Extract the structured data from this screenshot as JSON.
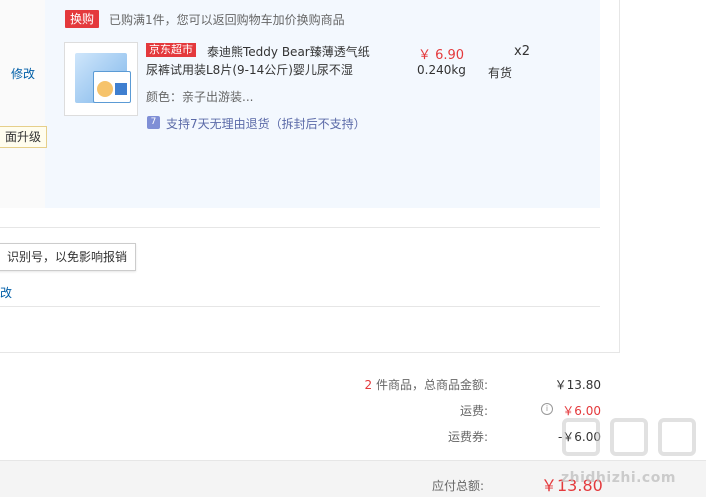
{
  "swap": {
    "tag": "换购",
    "note": "已购满1件，您可以返回购物车加价换购商品"
  },
  "product": {
    "store_tag": "京东超市",
    "name_line1": "泰迪熊Teddy Bear臻薄透气纸",
    "name_line2": "尿裤试用装L8片(9-14公斤)婴儿尿不湿",
    "price": "￥ 6.90",
    "weight": "0.240kg",
    "qty": "x2",
    "stock": "有货",
    "color": "颜色：亲子出游装...",
    "return_icon": "7",
    "return_policy": "支持7天无理由退货（拆封后不支持）"
  },
  "left": {
    "modify": "修改",
    "upgrade_tip": "面升级",
    "invoice_tip": "识别号，以免影响报销",
    "edit": "改"
  },
  "summary": {
    "count": "2",
    "count_label": " 件商品，总商品金额:",
    "total_goods": "￥13.80",
    "shipping_label": "运费:",
    "shipping": "￥6.00",
    "shipping_coupon_label": "运费券:",
    "shipping_coupon": "-￥6.00",
    "payable_label": "应付总额:",
    "payable": "￥13.80"
  },
  "watermark": {
    "text": "zhidhizhi.com"
  },
  "colors": {
    "accent_red": "#e4393c",
    "link_blue": "#005ea7",
    "block_bg": "#f3f8fe"
  }
}
